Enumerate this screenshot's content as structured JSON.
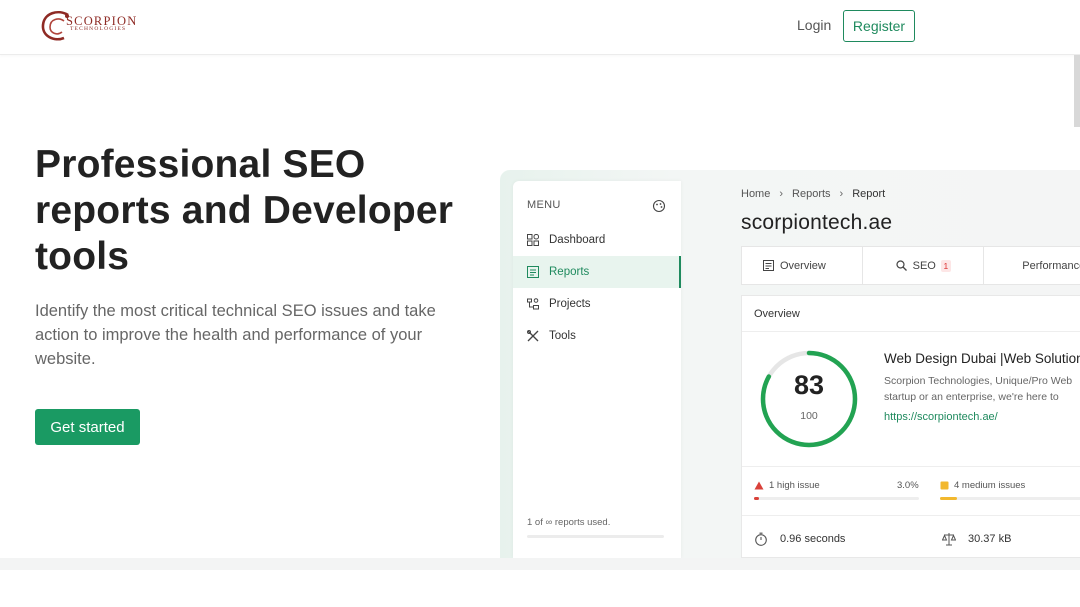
{
  "header": {
    "logo_text": "SCORPION",
    "logo_subtext": "TECHNOLOGIES",
    "login_label": "Login",
    "register_label": "Register"
  },
  "hero": {
    "title": "Professional SEO reports and Developer tools",
    "description": "Identify the most critical technical SEO issues and take action to improve the health and performance of your website.",
    "cta_label": "Get started"
  },
  "app": {
    "menu_label": "MENU",
    "sidebar": [
      {
        "label": "Dashboard",
        "icon": "grid-icon",
        "active": false
      },
      {
        "label": "Reports",
        "icon": "report-icon",
        "active": true
      },
      {
        "label": "Projects",
        "icon": "projects-icon",
        "active": false
      },
      {
        "label": "Tools",
        "icon": "tools-icon",
        "active": false
      }
    ],
    "usage_text": "1 of ∞ reports used.",
    "breadcrumb": [
      "Home",
      "Reports",
      "Report"
    ],
    "site_title": "scorpiontech.ae",
    "tabs": [
      {
        "label": "Overview",
        "icon": "overview-icon"
      },
      {
        "label": "SEO",
        "icon": "search-icon",
        "badge": "1"
      },
      {
        "label": "Performance",
        "icon": "gauge-icon"
      }
    ],
    "overview": {
      "heading": "Overview",
      "score": "83",
      "score_max": "100",
      "score_fraction": 0.83,
      "site_name": "Web Design Dubai |Web Solutions",
      "site_desc_line1": "Scorpion Technologies, Unique/Pro Web",
      "site_desc_line2": "startup or an enterprise, we're here to",
      "site_url": "https://scorpiontech.ae/",
      "high_issue": "1 high issue",
      "high_pct": "3.0%",
      "high_fraction": 0.03,
      "medium_issue": "4 medium issues",
      "medium_fraction": 0.12,
      "load_time": "0.96 seconds",
      "page_size": "30.37 kB"
    },
    "colors": {
      "accent": "#1f8a5e",
      "button": "#1a9a63",
      "high": "#d9413a",
      "medium": "#f2b82e"
    }
  }
}
